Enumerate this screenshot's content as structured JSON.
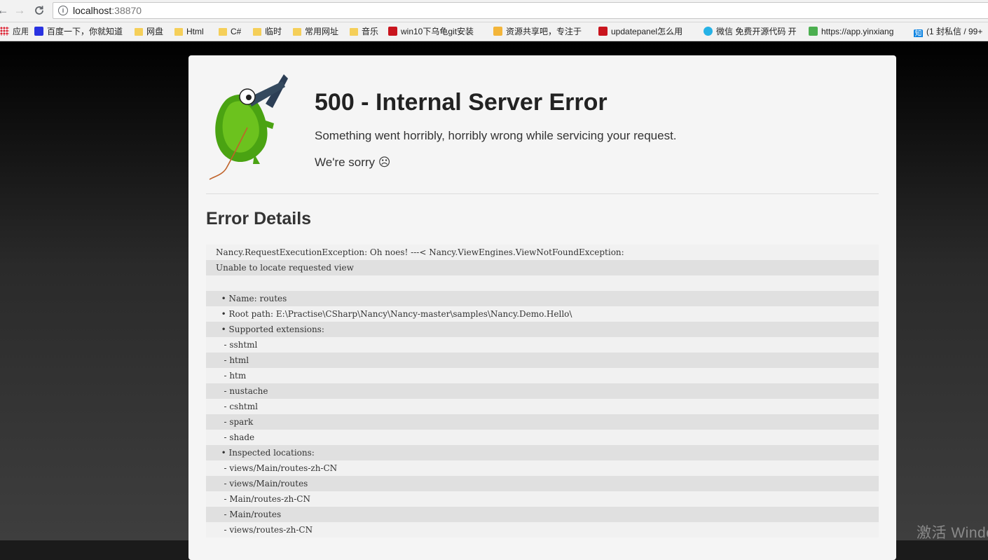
{
  "browser": {
    "url_host": "localhost",
    "url_port": ":38870",
    "bookmarks": [
      {
        "label": "应用",
        "icon": "apps-grid-icon",
        "kind": "apps"
      },
      {
        "label": "百度一下，你就知道",
        "icon": "baidu-paw-icon",
        "kind": "paw"
      },
      {
        "label": "网盘",
        "icon": "folder-icon",
        "kind": "folder"
      },
      {
        "label": "Html",
        "icon": "folder-icon",
        "kind": "folder"
      },
      {
        "label": "C#",
        "icon": "folder-icon",
        "kind": "folder"
      },
      {
        "label": "临时",
        "icon": "folder-icon",
        "kind": "folder"
      },
      {
        "label": "常用网址",
        "icon": "folder-icon",
        "kind": "folder"
      },
      {
        "label": "音乐",
        "icon": "folder-icon",
        "kind": "folder"
      },
      {
        "label": "win10下乌龟git安装",
        "icon": "csdn-icon",
        "kind": "csdn"
      },
      {
        "label": "资源共享吧，专注于",
        "icon": "note-icon",
        "kind": "note"
      },
      {
        "label": "updatepanel怎么用",
        "icon": "csdn-icon",
        "kind": "csdn"
      },
      {
        "label": "微信 免费开源代码 开",
        "icon": "cyan-logo-icon",
        "kind": "cyan"
      },
      {
        "label": "https://app.yinxiang",
        "icon": "evernote-icon",
        "kind": "green"
      },
      {
        "label": "(1 封私信 / 99+",
        "icon": "zhihu-icon",
        "kind": "zhi"
      }
    ]
  },
  "error": {
    "title": "500 - Internal Server Error",
    "message": "Something went horribly, horribly wrong while servicing your request.",
    "sorry": "We're sorry ☹",
    "details_heading": "Error Details",
    "trace_lines": [
      "Nancy.RequestExecutionException: Oh noes! ---< Nancy.ViewEngines.ViewNotFoundException:",
      "Unable to locate requested view",
      "",
      "  • Name: routes",
      "  • Root path: E:\\Practise\\CSharp\\Nancy\\Nancy-master\\samples\\Nancy.Demo.Hello\\",
      "  • Supported extensions:",
      "   - sshtml",
      "   - html",
      "   - htm",
      "   - nustache",
      "   - cshtml",
      "   - spark",
      "   - shade",
      "  • Inspected locations:",
      "   - views/Main/routes-zh-CN",
      "   - views/Main/routes",
      "   - Main/routes-zh-CN",
      "   - Main/routes",
      "   - views/routes-zh-CN"
    ]
  },
  "os": {
    "watermark": "激活 Windo"
  }
}
